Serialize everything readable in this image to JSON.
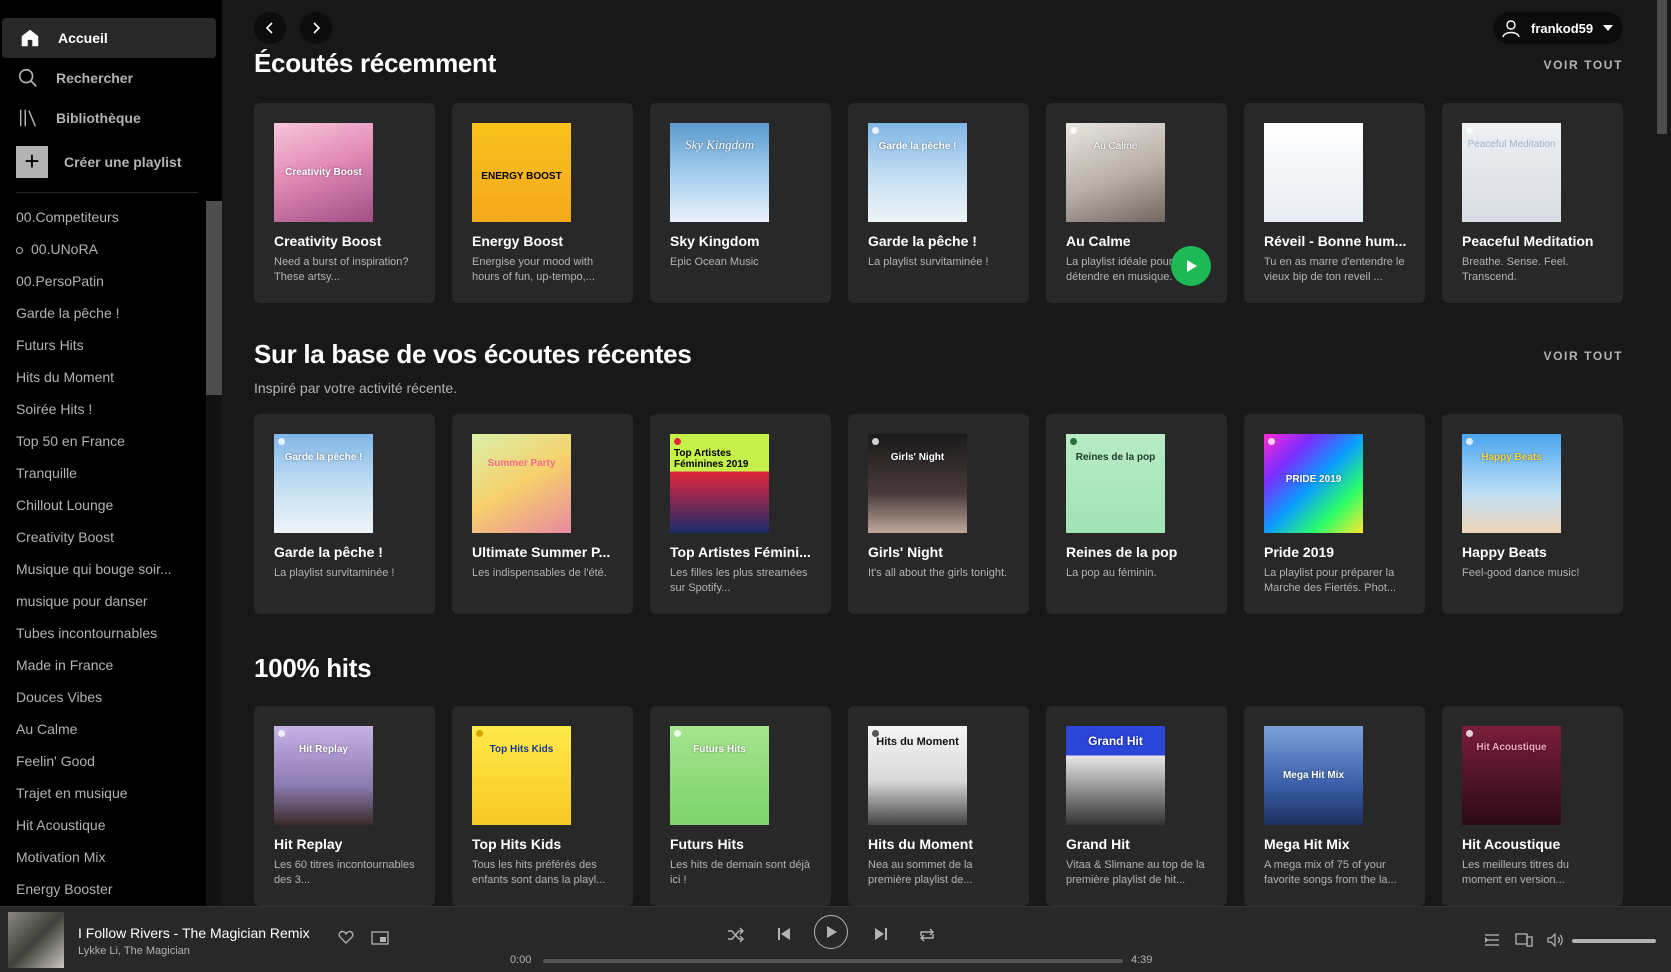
{
  "sidebar": {
    "nav": [
      {
        "label": "Accueil",
        "icon": "home-icon"
      },
      {
        "label": "Rechercher",
        "icon": "search-icon"
      },
      {
        "label": "Bibliothèque",
        "icon": "library-icon"
      }
    ],
    "create_playlist": "Créer une playlist",
    "playlists": [
      "00.Competiteurs",
      "00.UNoRA",
      "00.PersoPatin",
      "Garde la pêche !",
      "Futurs Hits",
      "Hits du Moment",
      "Soirée Hits !",
      "Top 50 en France",
      "Tranquille",
      "Chillout Lounge",
      "Creativity Boost",
      "Musique qui bouge soir...",
      "musique pour danser",
      "Tubes incontournables",
      "Made in France",
      "Douces Vibes",
      "Au Calme",
      "Feelin' Good",
      "Trajet en musique",
      "Hit Acoustique",
      "Motivation Mix",
      "Energy Booster"
    ]
  },
  "header": {
    "username": "frankod59"
  },
  "sections": [
    {
      "title": "Écoutés récemment",
      "see_all": "VOIR TOUT",
      "cards": [
        {
          "title": "Creativity Boost",
          "desc": "Need a burst of inspiration? These artsy...",
          "art_label": "Creativity Boost",
          "bg": "linear-gradient(160deg,#f7c6dc,#e38bb6 45%,#a04e86)"
        },
        {
          "title": "Energy Boost",
          "desc": "Energise your mood with hours of fun, up-tempo,...",
          "art_label": "ENERGY BOOST",
          "bg": "linear-gradient(180deg,#f8c21c,#f4a81b)"
        },
        {
          "title": "Sky Kingdom",
          "desc": "Epic Ocean Music",
          "art_label": "Sky Kingdom",
          "bg": "linear-gradient(180deg,#5a9ccf,#a8d0ef 55%,#e9f2fa)"
        },
        {
          "title": "Garde la pêche !",
          "desc": "La playlist survitaminée !",
          "art_label": "Garde la pêche !",
          "bg": "linear-gradient(180deg,#7fb6e6,#c7e0f3 55%,#eef4f8)"
        },
        {
          "title": "Au Calme",
          "desc": "La playlist idéale pour détendre en musique.",
          "art_label": "Au Calme",
          "bg": "linear-gradient(160deg,#e9e6e2,#b8aea5 55%,#6f6660)"
        },
        {
          "title": "Réveil - Bonne hum...",
          "desc": "Tu en as marre d'entendre le vieux bip de ton reveil ...",
          "art_label": "",
          "bg": "linear-gradient(180deg,#ffffff,#e6ecf3)"
        },
        {
          "title": "Peaceful Meditation",
          "desc": "Breathe. Sense. Feel. Transcend.",
          "art_label": "Peaceful Meditation",
          "bg": "linear-gradient(180deg,#eef0f2,#d7dde3)"
        }
      ]
    },
    {
      "title": "Sur la base de vos écoutes récentes",
      "subtitle": "Inspiré par votre activité récente.",
      "see_all": "VOIR TOUT",
      "cards": [
        {
          "title": "Garde la pêche !",
          "desc": "La playlist survitaminée !",
          "art_label": "Garde la pêche !",
          "bg": "linear-gradient(180deg,#7fb6e6,#c7e0f3 55%,#eef4f8)"
        },
        {
          "title": "Ultimate Summer P...",
          "desc": "Les indispensables de l'été.",
          "art_label": "Summer Party",
          "bg": "linear-gradient(150deg,#d9f0a8,#f7d06b 50%,#e88aa0)"
        },
        {
          "title": "Top Artistes Fémini...",
          "desc": "Les filles les plus streamées sur Spotify...",
          "art_label": "Top Artistes Féminines 2019",
          "bg": "linear-gradient(180deg,#c6f04a 38%,#e2263a 38%,#1a2a6c)"
        },
        {
          "title": "Girls' Night",
          "desc": "It's all about the girls tonight.",
          "art_label": "Girls' Night",
          "bg": "linear-gradient(180deg,#1a1a1a,#4a3a3a 60%,#bfa79a)"
        },
        {
          "title": "Reines de la pop",
          "desc": "La pop au féminin.",
          "art_label": "Reines de la pop",
          "bg": "linear-gradient(180deg,#b8ebc6,#9fe3b3)"
        },
        {
          "title": "Pride 2019",
          "desc": "La playlist pour préparer la Marche des Fiertés. Phot...",
          "art_label": "PRIDE 2019",
          "bg": "linear-gradient(135deg,#ff2ad4,#7b2bff 25%,#0a9cff 50%,#2bff6a 75%,#ffe72b)"
        },
        {
          "title": "Happy Beats",
          "desc": "Feel-good dance music!",
          "art_label": "Happy Beats",
          "bg": "linear-gradient(180deg,#4aa5f0,#bfe0f7 60%,#f0d5b5)"
        }
      ]
    },
    {
      "title": "100% hits",
      "cards": [
        {
          "title": "Hit Replay",
          "desc": "Les 60 titres incontournables des 3...",
          "art_label": "Hit Replay",
          "bg": "linear-gradient(180deg,#c8b2e8,#8c7bb0 60%,#3b2a2a)"
        },
        {
          "title": "Top Hits Kids",
          "desc": "Tous les hits préférés des enfants sont dans la playl...",
          "art_label": "Top Hits Kids",
          "bg": "linear-gradient(180deg,#ffe94a,#f8c923)"
        },
        {
          "title": "Futurs Hits",
          "desc": "Les hits de demain sont déjà ici !",
          "art_label": "Futurs Hits",
          "bg": "linear-gradient(180deg,#a6e58e,#7bd36a)"
        },
        {
          "title": "Hits du Moment",
          "desc": "Nea au sommet de la première playlist de...",
          "art_label": "Hits du Moment",
          "bg": "linear-gradient(180deg,#f5f5f5,#d9d9d9 55%,#444)"
        },
        {
          "title": "Grand Hit",
          "desc": "Vitaa & Slimane au top de la première playlist de hit...",
          "art_label": "Grand Hit",
          "bg": "linear-gradient(180deg,#2b46d8 30%,#e8e8e8 30%,#333)"
        },
        {
          "title": "Mega Hit Mix",
          "desc": "A mega mix of 75 of your favorite songs from the la...",
          "art_label": "Mega Hit Mix",
          "bg": "linear-gradient(180deg,#7ba0d9,#3a5ea8 60%,#1e2f5e)"
        },
        {
          "title": "Hit Acoustique",
          "desc": "Les meilleurs titres du moment en version...",
          "art_label": "Hit Acoustique",
          "bg": "linear-gradient(180deg,#7a1d3a,#4a1226 60%,#2b0a16)"
        }
      ]
    }
  ],
  "player": {
    "track_title": "I Follow Rivers - The Magician Remix",
    "artist": "Lykke Li, The Magician",
    "time_elapsed": "0:00",
    "time_total": "4:39",
    "progress": 0
  },
  "colors": {
    "accent": "#1db954",
    "bg_main": "#181818",
    "bg_sidebar": "#000000",
    "card": "#282828"
  }
}
